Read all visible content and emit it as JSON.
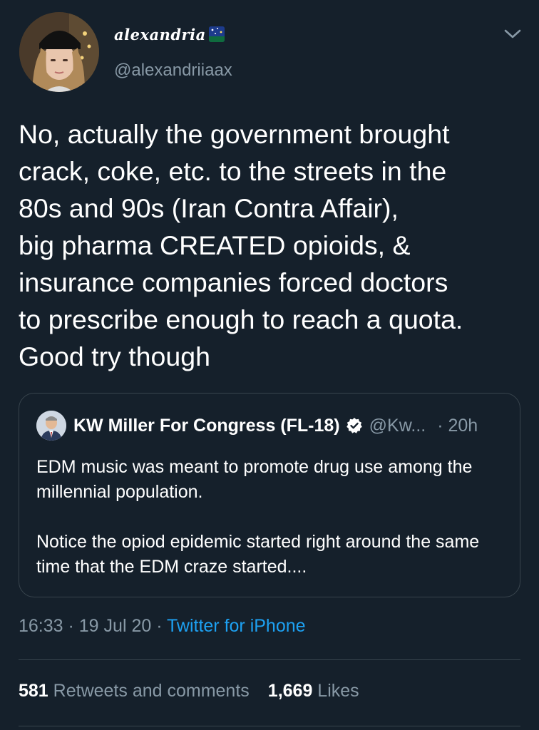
{
  "tweet": {
    "display_name": "alexandria",
    "handle": "@alexandriiaax",
    "text": "No, actually the government brought\ncrack, coke, etc. to the streets in the\n80s and 90s  (Iran Contra Affair),\nbig pharma CREATED opioids, &\ninsurance companies forced doctors\nto prescribe enough to reach a quota.\nGood try though"
  },
  "quote": {
    "name": "KW Miller For Congress (FL-18)",
    "handle": "@Kw...",
    "time": "· 20h",
    "paragraph1": "EDM music was meant to promote drug use among the millennial population.",
    "paragraph2": "Notice the opiod epidemic started right around the same time that the EDM craze started...."
  },
  "meta": {
    "time": "16:33",
    "sep1": " · ",
    "date": "19 Jul 20",
    "sep2": " · ",
    "source": "Twitter for iPhone"
  },
  "stats": {
    "retweets_count": "581",
    "retweets_label": " Retweets and comments",
    "likes_count": "1,669",
    "likes_label": " Likes"
  },
  "colors": {
    "background": "#15202b",
    "secondary_text": "#8899a6",
    "link": "#1da1f2",
    "border": "#38444d"
  },
  "icons": {
    "caret": "chevron-down-icon",
    "verified": "verified-badge-icon",
    "name_emoji": "sparkles-night-sky-emoji"
  }
}
